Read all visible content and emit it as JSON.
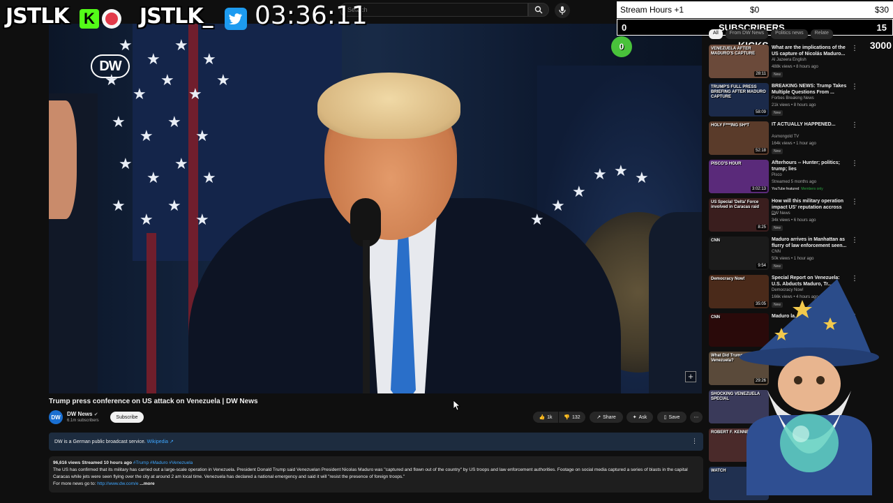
{
  "overlay": {
    "brand_left": "JSTLK",
    "kick_letter": "K",
    "brand_right": "JSTLK_",
    "timer": "03:36:11",
    "stream_hours_label": "Stream Hours +1",
    "stream_hours_mid": "$0",
    "stream_hours_max": "$30",
    "subs_current": "0",
    "subs_label": "SUBSCRIBERS",
    "subs_goal": "15",
    "kicks_current": "0",
    "kicks_label": "KICKS",
    "kicks_goal": "3000",
    "colors": {
      "kick_green": "#53fc18",
      "twitter_blue": "#1d9bf0",
      "live_red": "#e23a4a"
    }
  },
  "search": {
    "placeholder": "Search"
  },
  "video": {
    "logo_text": "DW",
    "title": "Trump press conference on US attack on Venezuela | DW News",
    "channel": {
      "avatar_text": "DW",
      "name": "DW News",
      "subscribers": "6.1m subscribers",
      "subscribe_label": "Subscribe"
    },
    "actions": {
      "likes": "1k",
      "dislikes": "132",
      "share": "Share",
      "ask": "Ask",
      "save": "Save"
    },
    "info_card": {
      "text": "DW is a German public broadcast service.",
      "link": "Wikipedia"
    },
    "description": {
      "stats": "96,616 views  Streamed 10 hours ago",
      "tags": "#Trump #Maduro #Venezuela",
      "body": "The US has confirmed that its military has carried out a large-scale operation in Venezuela. President Donald Trump said Venezuelan President Nicolas Maduro was \"captured and flown out of the country\" by US troops and law enforcement authorities. Footage on social media captured a series of blasts in the capital Caracas while jets were seen flying over the city at around 2 am local time. Venezuela has declared a national emergency and said it will \"resist the presence of foreign troops.\"",
      "more_news_label": "For more news go to:",
      "more_news_link": "http://www.dw.com/e",
      "more": "...more"
    }
  },
  "sidebar": {
    "chips": [
      "All",
      "From DW News",
      "Politics news",
      "Relate"
    ],
    "recommendations": [
      {
        "title": "What are the implications of the US capture of Nicolás Maduro...",
        "channel": "Al Jazeera English",
        "meta": "488k views • 8 hours ago",
        "badge": "New",
        "duration": "28:11",
        "thumb_color": "#6b4a3a"
      },
      {
        "title": "BREAKING NEWS: Trump Takes Multiple Questions From ...",
        "channel": "Forbes Breaking News",
        "meta": "21k views • 8 hours ago",
        "badge": "New",
        "duration": "58:09",
        "thumb_color": "#1b2a4a"
      },
      {
        "title": "IT ACTUALLY HAPPENED...",
        "channel": "Asmongold TV",
        "meta": "164k views • 1 hour ago",
        "badge": "New",
        "duration": "52:18",
        "thumb_color": "#5a3b2a"
      },
      {
        "title": "Afterhours -- Hunter; politics; trump; lies",
        "channel": "Pisco",
        "meta": "Streamed 5 months ago",
        "badge": "YouTube featured",
        "badge2": "Members only",
        "duration": "3:02:13",
        "thumb_color": "#5a2a7a"
      },
      {
        "title": "How will this military operation impact US' reputation accross ...",
        "channel": "DW News",
        "meta": "34k views • 6 hours ago",
        "badge": "New",
        "duration": "8:25",
        "thumb_color": "#3a1e1e"
      },
      {
        "title": "Maduro arrives in Manhattan as flurry of law enforcement seen...",
        "channel": "CNN",
        "meta": "50k views • 1 hour ago",
        "badge": "New",
        "duration": "9:54",
        "thumb_color": "#1b1b1b"
      },
      {
        "title": "Special Report on Venezuela: U.S. Abducts Maduro, Tr...",
        "channel": "Democracy Now!",
        "meta": "166k views • 4 hours ago",
        "badge": "New",
        "duration": "35:05",
        "thumb_color": "#4a2a1a"
      },
      {
        "title": "Maduro la... expecte...",
        "channel": "",
        "meta": "",
        "badge": "",
        "duration": "",
        "thumb_color": "#2a0a0a"
      },
      {
        "title": "",
        "channel": "",
        "meta": "",
        "badge": "",
        "duration": "29:26",
        "thumb_color": "#5a4a3a"
      },
      {
        "title": "",
        "channel": "",
        "meta": "",
        "badge": "",
        "duration": "",
        "thumb_color": "#3a3a5a"
      },
      {
        "title": "",
        "channel": "",
        "meta": "",
        "badge": "",
        "duration": "",
        "thumb_color": "#4a2a2a"
      },
      {
        "title": "",
        "channel": "",
        "meta": "",
        "badge": "",
        "duration": "",
        "thumb_color": "#203050"
      }
    ],
    "thumb_texts": [
      "VENEZUELA AFTER MADURO'S CAPTURE",
      "TRUMP'S FULL PRESS BRIEFING AFTER MADURO CAPTURE",
      "HOLY F***ING SH*T",
      "PISCO'S HOUR",
      "US Special 'Delta' Force involved in Caracas raid",
      "CNN",
      "Democracy Now!",
      "CNN",
      "What Did Trump Just Do in Venezuela?",
      "SHOCKING VENEZUELA SPECIAL",
      "ROBERT F. KENNEDY",
      "WATCH"
    ]
  }
}
